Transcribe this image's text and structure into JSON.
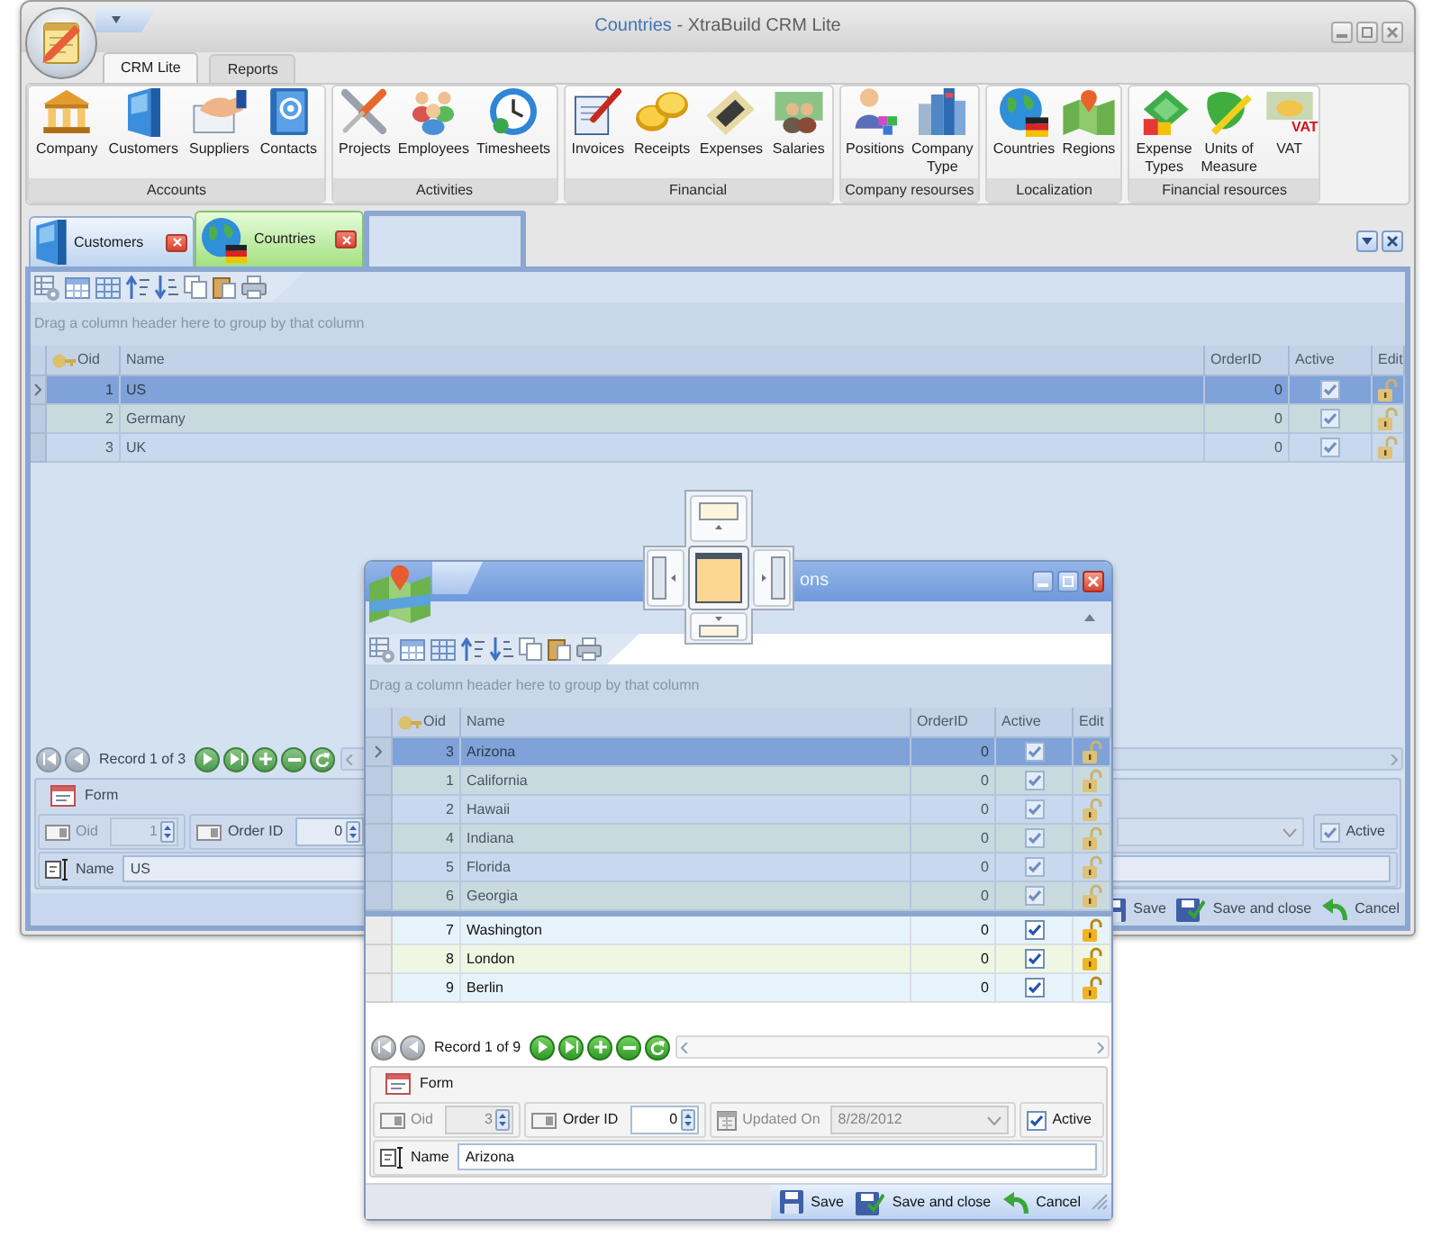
{
  "main_window": {
    "title": {
      "document": "Countries",
      "app": "- XtraBuild CRM Lite"
    },
    "ribbon_tabs": [
      {
        "label": "CRM Lite",
        "selected": true
      },
      {
        "label": "Reports",
        "selected": false
      }
    ],
    "ribbon_groups": [
      {
        "label": "Accounts",
        "items": [
          {
            "label": "Company"
          },
          {
            "label": "Customers"
          },
          {
            "label": "Suppliers"
          },
          {
            "label": "Contacts"
          }
        ]
      },
      {
        "label": "Activities",
        "items": [
          {
            "label": "Projects"
          },
          {
            "label": "Employees"
          },
          {
            "label": "Timesheets"
          }
        ]
      },
      {
        "label": "Financial",
        "items": [
          {
            "label": "Invoices"
          },
          {
            "label": "Receipts"
          },
          {
            "label": "Expenses"
          },
          {
            "label": "Salaries"
          }
        ]
      },
      {
        "label": "Company resourses",
        "items": [
          {
            "label": "Positions"
          },
          {
            "label": "Company\nType"
          }
        ]
      },
      {
        "label": "Localization",
        "items": [
          {
            "label": "Countries"
          },
          {
            "label": "Regions"
          }
        ]
      },
      {
        "label": "Financial resources",
        "items": [
          {
            "label": "Expense\nTypes"
          },
          {
            "label": "Units of\nMeasure"
          },
          {
            "label": "VAT",
            "icon_text": "VAT"
          }
        ]
      }
    ],
    "document_tabs": [
      {
        "label": "Customers",
        "selected": false
      },
      {
        "label": "Countries",
        "selected": true
      }
    ],
    "group_panel_hint": "Drag a column header here to group by that column",
    "grid": {
      "columns": [
        "Oid",
        "Name",
        "OrderID",
        "Active",
        "Edit"
      ],
      "rows": [
        {
          "oid": "1",
          "name": "US",
          "order_id": "0",
          "active": true,
          "selected": true
        },
        {
          "oid": "2",
          "name": "Germany",
          "order_id": "0",
          "active": true,
          "selected": false
        },
        {
          "oid": "3",
          "name": "UK",
          "order_id": "0",
          "active": true,
          "selected": false
        }
      ]
    },
    "navigator": {
      "buttons_left": [
        {
          "disabled": true
        },
        {
          "disabled": true
        }
      ],
      "record": "Record 1 of 3",
      "buttons_right": [
        {
          "disabled": false
        },
        {
          "disabled": false
        },
        {
          "disabled": false
        },
        {
          "disabled": false
        },
        {
          "disabled": false
        }
      ]
    },
    "form": {
      "title": "Form",
      "fields": [
        {
          "kind": "spin",
          "label": "Oid",
          "value": "1",
          "disabled": true
        },
        {
          "kind": "spin",
          "label": "Order ID",
          "value": "0",
          "disabled": false
        },
        {
          "kind": "date",
          "disabled": true
        },
        {
          "kind": "check",
          "label": "Active",
          "checked": true
        }
      ],
      "name_field": {
        "label": "Name",
        "value": "US"
      }
    },
    "actions": [
      {
        "label": "Save"
      },
      {
        "label": "Save and close"
      },
      {
        "label": "Cancel"
      }
    ]
  },
  "floating_window": {
    "title": "ons",
    "group_panel_hint": "Drag a column header here to group by that column",
    "grid": {
      "columns": [
        "Oid",
        "Name",
        "OrderID",
        "Active",
        "Edit"
      ],
      "rows": [
        {
          "oid": "3",
          "name": "Arizona",
          "order_id": "0",
          "active": true,
          "selected": true
        },
        {
          "oid": "1",
          "name": "California",
          "order_id": "0",
          "active": true,
          "selected": false
        },
        {
          "oid": "2",
          "name": "Hawaii",
          "order_id": "0",
          "active": true,
          "selected": false
        },
        {
          "oid": "4",
          "name": "Indiana",
          "order_id": "0",
          "active": true,
          "selected": false
        },
        {
          "oid": "5",
          "name": "Florida",
          "order_id": "0",
          "active": true,
          "selected": false
        },
        {
          "oid": "6",
          "name": "Georgia",
          "order_id": "0",
          "active": true,
          "selected": false
        },
        {
          "oid": "7",
          "name": "Washington",
          "order_id": "0",
          "active": true,
          "selected": false
        },
        {
          "oid": "8",
          "name": "London",
          "order_id": "0",
          "active": true,
          "selected": false
        },
        {
          "oid": "9",
          "name": "Berlin",
          "order_id": "0",
          "active": true,
          "selected": false
        }
      ]
    },
    "navigator": {
      "buttons_left": [
        {
          "disabled": true
        },
        {
          "disabled": true
        }
      ],
      "record": "Record 1 of 9",
      "buttons_right": [
        {
          "disabled": false
        },
        {
          "disabled": false
        },
        {
          "disabled": false
        },
        {
          "disabled": false
        },
        {
          "disabled": false
        }
      ]
    },
    "form": {
      "title": "Form",
      "fields": [
        {
          "kind": "spin",
          "label": "Oid",
          "value": "3",
          "disabled": true
        },
        {
          "kind": "spin",
          "label": "Order ID",
          "value": "0",
          "disabled": false
        },
        {
          "kind": "date",
          "label": "Updated On",
          "value": "8/28/2012",
          "disabled": true
        },
        {
          "kind": "check",
          "label": "Active",
          "checked": true
        }
      ],
      "name_field": {
        "label": "Name",
        "value": "Arizona"
      }
    },
    "actions": [
      {
        "label": "Save"
      },
      {
        "label": "Save and close"
      },
      {
        "label": "Cancel"
      }
    ]
  }
}
